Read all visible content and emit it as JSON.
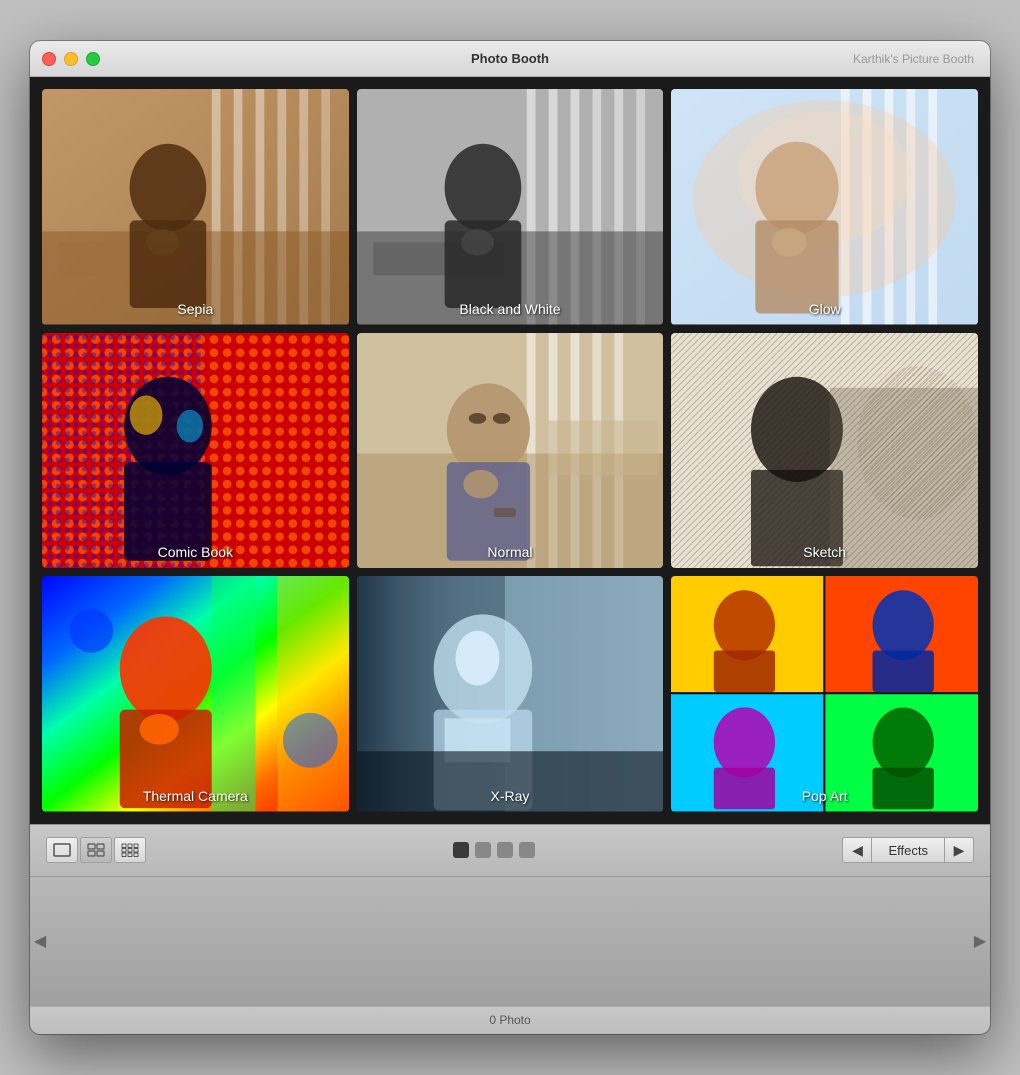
{
  "window": {
    "title": "Photo Booth",
    "subtitle": "Karthik's Picture Booth"
  },
  "toolbar": {
    "effects_label": "Effects",
    "status": "0 Photo"
  },
  "view_buttons": [
    {
      "id": "single",
      "icon": "▣",
      "label": "single-view"
    },
    {
      "id": "grid4",
      "icon": "⊞",
      "label": "grid-4-view"
    },
    {
      "id": "grid9",
      "icon": "⊟",
      "label": "grid-9-view"
    }
  ],
  "dots": [
    {
      "color": "dark"
    },
    {
      "color": "medium"
    },
    {
      "color": "medium"
    },
    {
      "color": "medium"
    }
  ],
  "effects": [
    {
      "id": "sepia",
      "label": "Sepia",
      "type": "sepia"
    },
    {
      "id": "bw",
      "label": "Black and White",
      "type": "bw"
    },
    {
      "id": "glow",
      "label": "Glow",
      "type": "glow"
    },
    {
      "id": "comic",
      "label": "Comic Book",
      "type": "comic"
    },
    {
      "id": "normal",
      "label": "Normal",
      "type": "normal"
    },
    {
      "id": "sketch",
      "label": "Sketch",
      "type": "sketch"
    },
    {
      "id": "thermal",
      "label": "Thermal Camera",
      "type": "thermal"
    },
    {
      "id": "xray",
      "label": "X-Ray",
      "type": "xray"
    },
    {
      "id": "popart",
      "label": "Pop Art",
      "type": "popart"
    }
  ]
}
